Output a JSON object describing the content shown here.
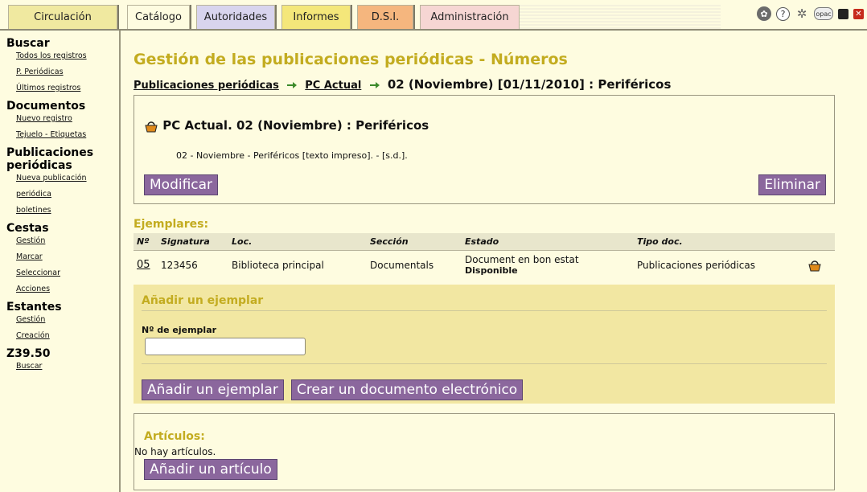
{
  "tabs": [
    {
      "label": "Circulación"
    },
    {
      "label": "Catálogo"
    },
    {
      "label": "Autoridades"
    },
    {
      "label": "Informes"
    },
    {
      "label": "D.S.I."
    },
    {
      "label": "Administración"
    }
  ],
  "toolbar": {
    "opac_label": "opac",
    "icons": [
      "palette-icon",
      "help-icon",
      "settings-icon",
      "opac-icon",
      "save-icon",
      "close-icon"
    ]
  },
  "sidebar": {
    "sections": [
      {
        "title": "Buscar",
        "items": [
          "Todos los registros",
          "P. Periódicas",
          "Últimos registros"
        ]
      },
      {
        "title": "Documentos",
        "items": [
          "Nuevo registro",
          "Tejuelo - Etiquetas"
        ]
      },
      {
        "title": "Publicaciones periódicas",
        "items": [
          "Nueva publicación",
          "periódica",
          "boletines"
        ]
      },
      {
        "title": "Cestas",
        "items": [
          "Gestión",
          "Marcar",
          "Seleccionar",
          "Acciones"
        ]
      },
      {
        "title": "Estantes",
        "items": [
          "Gestión",
          "Creación"
        ]
      },
      {
        "title": "Z39.50",
        "items": [
          "Buscar"
        ]
      }
    ]
  },
  "page": {
    "title": "Gestión de las publicaciones periódicas - Números",
    "breadcrumb": {
      "link1": "Publicaciones periódicas",
      "link2": "PC Actual",
      "current": "02 (Noviembre) [01/11/2010] : Periféricos"
    }
  },
  "issue": {
    "heading": "PC Actual. 02 (Noviembre) : Periféricos",
    "description": "02 - Noviembre - Periféricos [texto impreso]. - [s.d.].",
    "modify_label": "Modificar",
    "delete_label": "Eliminar"
  },
  "ejemplares": {
    "title": "Ejemplares:",
    "columns": [
      "Nº",
      "Signatura",
      "Loc.",
      "Sección",
      "Estado",
      "Tipo doc."
    ],
    "rows": [
      {
        "num": "05",
        "signatura": "123456",
        "loc": "Biblioteca principal",
        "seccion": "Documentals",
        "estado": "Document en bon estat",
        "estado2": "Disponible",
        "tipo": "Publicaciones periódicas"
      }
    ]
  },
  "add_copy": {
    "title": "Añadir un ejemplar",
    "field_label": "Nº de ejemplar",
    "field_value": "",
    "add_button": "Añadir un ejemplar",
    "electronic_button": "Crear un documento electrónico"
  },
  "articles": {
    "title": "Artículos:",
    "empty_text": "No hay artículos.",
    "add_button": "Añadir un artículo"
  }
}
